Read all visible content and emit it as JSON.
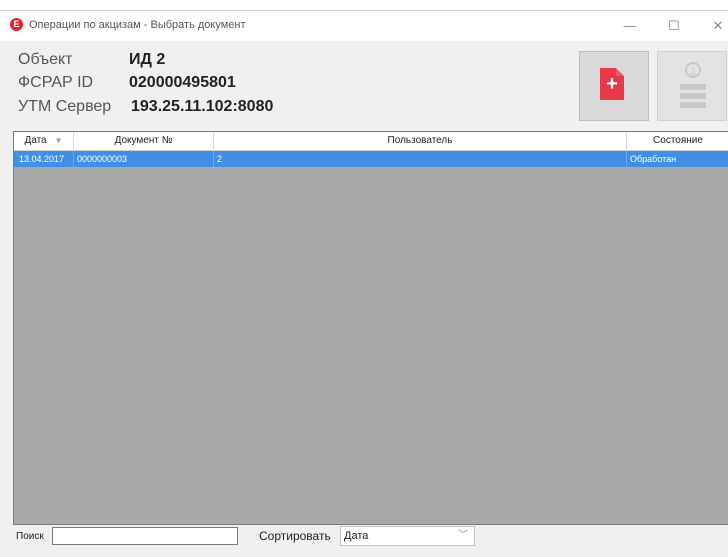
{
  "window": {
    "title": "Операции по акцизам - Выбрать документ",
    "app_icon_letter": "E",
    "controls": {
      "minimize": "—",
      "maximize": "☐",
      "close": "✕"
    }
  },
  "info": {
    "object_label": "Объект",
    "object_value": "ИД 2",
    "fsrar_label": "ФСРАР ID",
    "fsrar_value": "020000495801",
    "utm_label": "УТМ Сервер",
    "utm_value": "193.25.11.102:8080"
  },
  "buttons": {
    "add_document_icon": "document-add-icon",
    "load_server_icon": "server-download-icon",
    "plus_glyph": "+",
    "download_glyph": "⇩"
  },
  "grid": {
    "columns": [
      "Дата",
      "Документ №",
      "Пользователь",
      "Состояние"
    ],
    "rows": [
      {
        "date": "13.04.2017",
        "doc": "0000000003",
        "user": "2",
        "state": "Обработан"
      }
    ]
  },
  "footer": {
    "search_label": "Поиск",
    "search_value": "",
    "sort_label": "Сортировать",
    "sort_value": "Дата"
  },
  "colors": {
    "accent": "#e8394b",
    "selection": "#3f8fe6",
    "grid_background": "#a9a9a9"
  }
}
